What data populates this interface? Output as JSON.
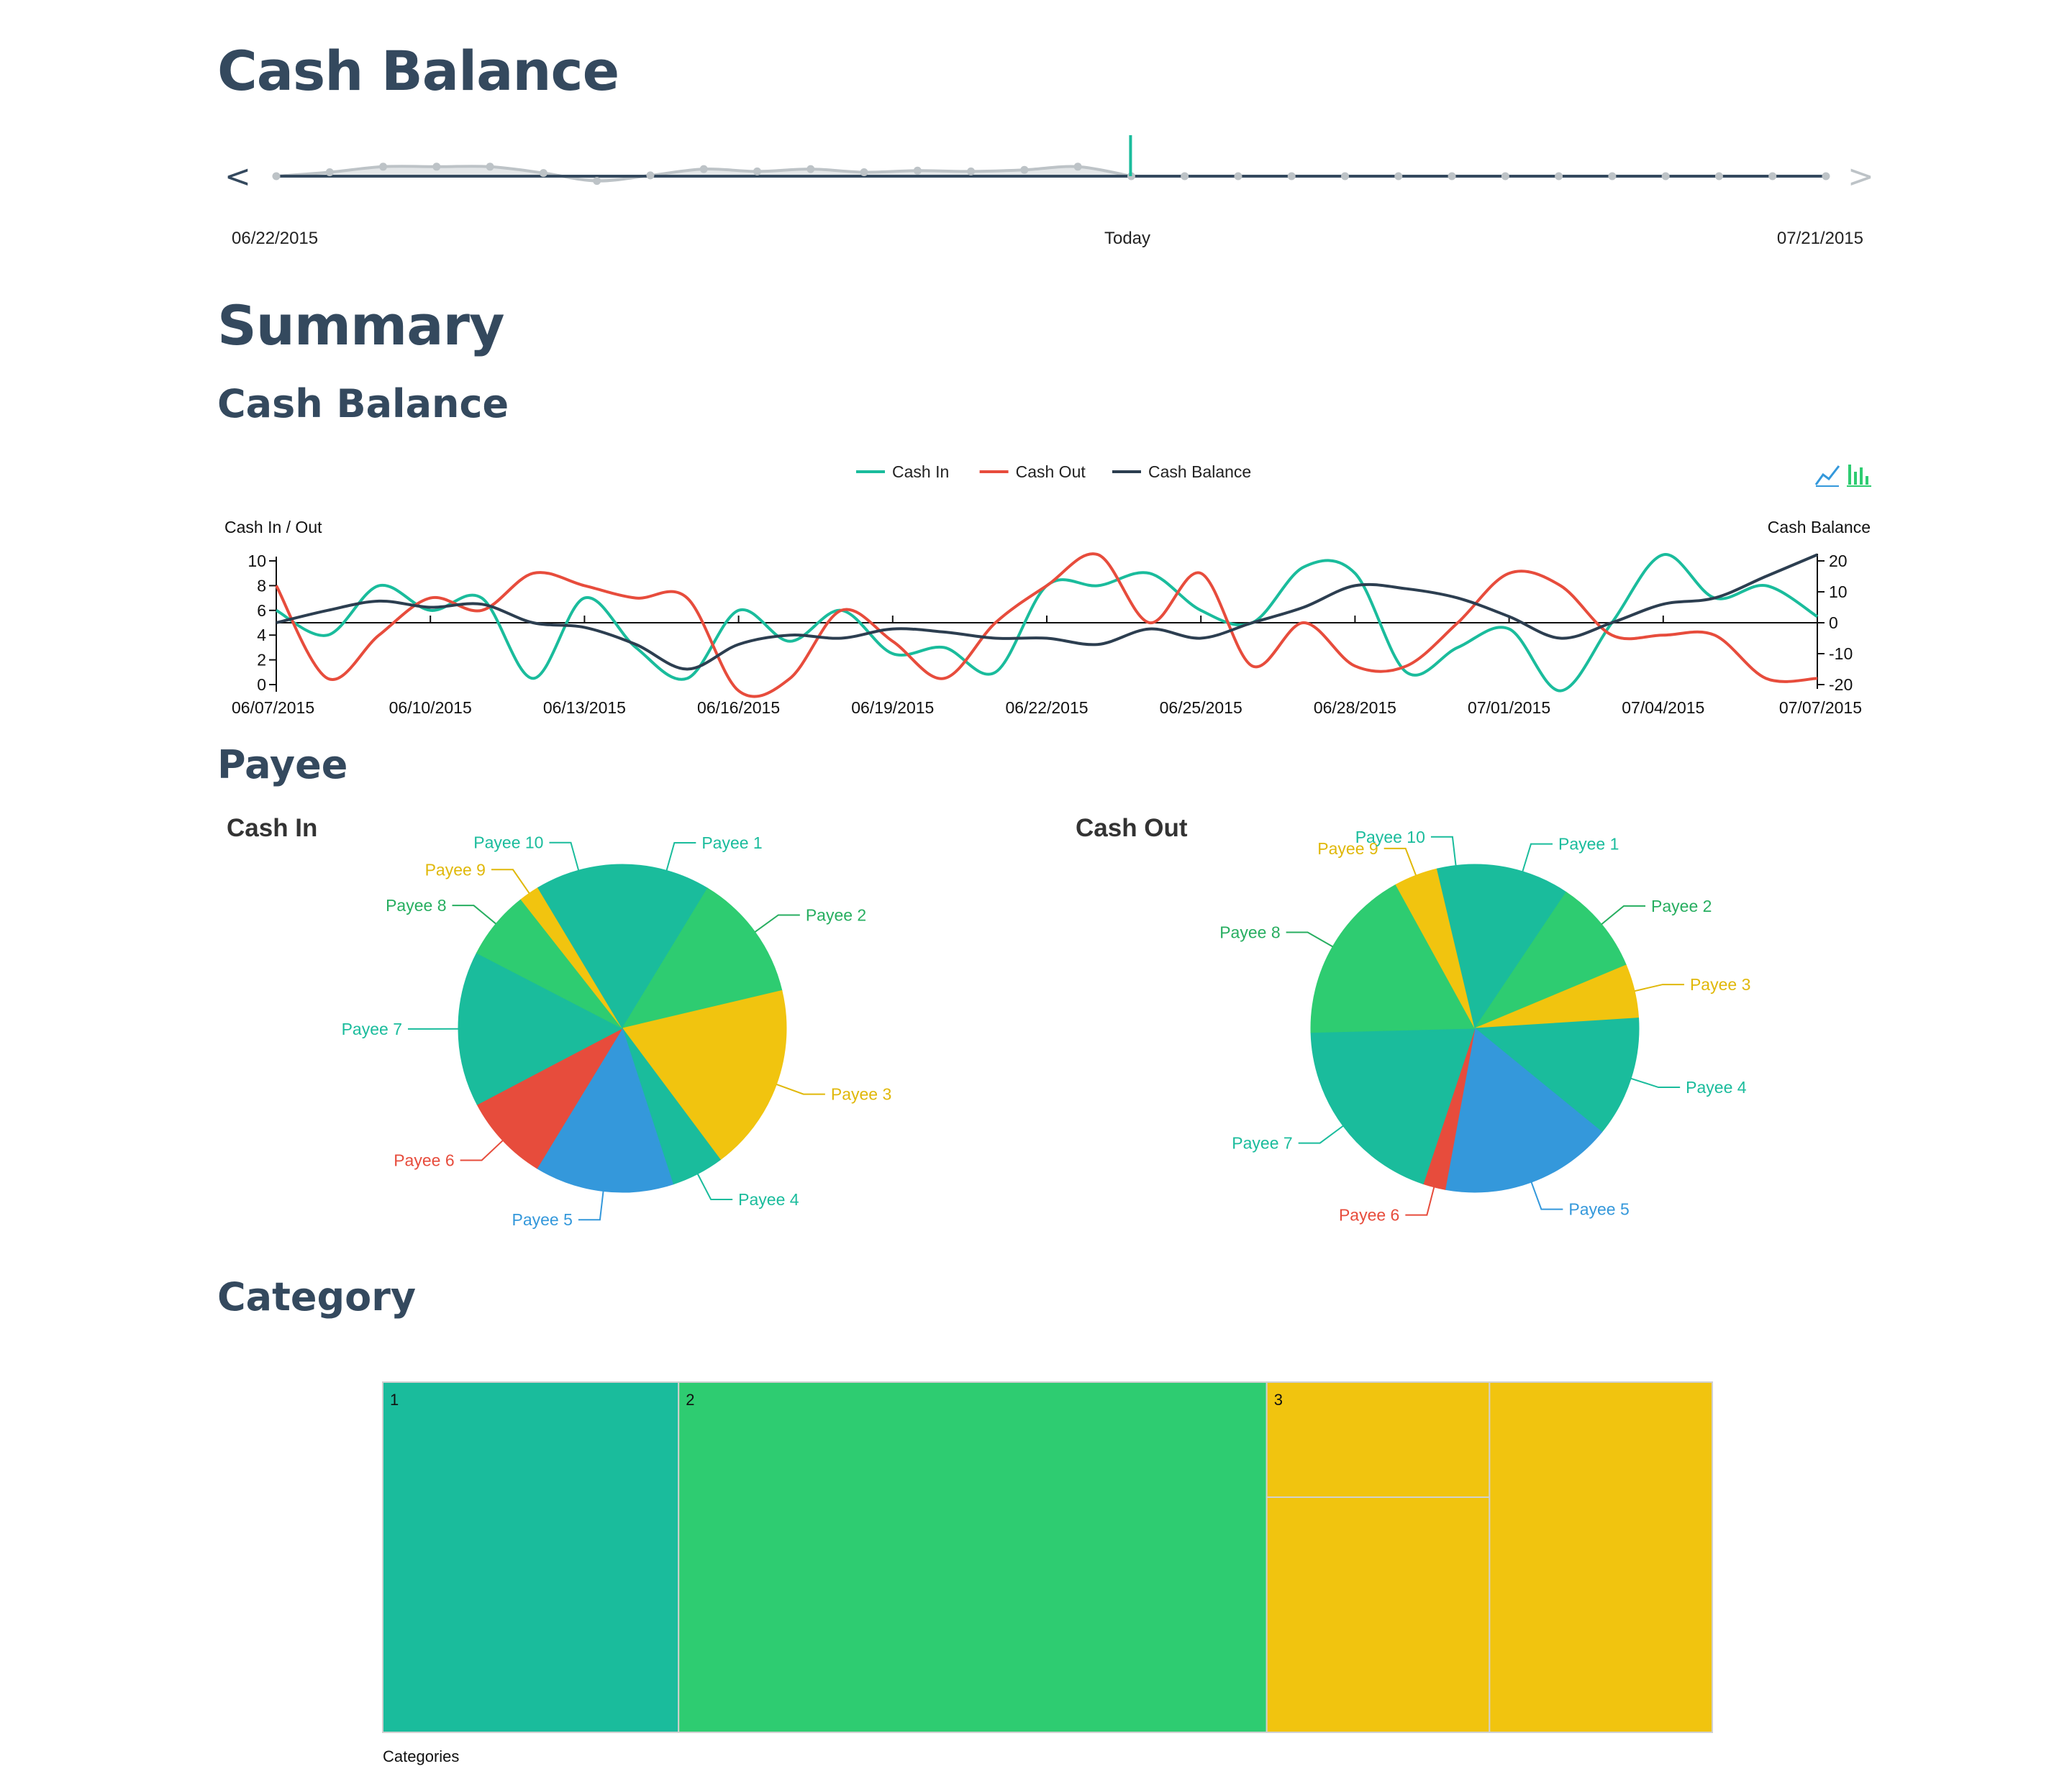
{
  "page": {
    "title": "Cash Balance",
    "summary_title": "Summary",
    "cash_balance_title": "Cash Balance",
    "payee_title": "Payee",
    "category_title": "Category"
  },
  "timeline": {
    "prev_label": "<",
    "next_label": ">",
    "start_label": "06/22/2015",
    "today_label": "Today",
    "end_label": "07/21/2015",
    "values": [
      0,
      0.5,
      1.2,
      1.2,
      1.2,
      0.4,
      -0.6,
      0.1,
      0.9,
      0.6,
      0.9,
      0.5,
      0.7,
      0.6,
      0.8,
      1.2,
      0,
      0,
      0,
      0,
      0,
      0,
      0,
      0,
      0,
      0,
      0,
      0,
      0,
      0
    ],
    "today_index": 16,
    "colors": {
      "line": "#bdc3c7",
      "fill": "#e3e6e8",
      "future": "#34495e",
      "today": "#1abc9c"
    }
  },
  "chart_data": [
    {
      "type": "line",
      "title": "",
      "legend": [
        {
          "name": "Cash In",
          "color": "#1abc9c"
        },
        {
          "name": "Cash Out",
          "color": "#e74c3c"
        },
        {
          "name": "Cash Balance",
          "color": "#2c3e50"
        }
      ],
      "legend_position": "top-center",
      "ylabel_left": "Cash In / Out",
      "ylabel_right": "Cash Balance",
      "ylim_left": [
        0,
        10
      ],
      "ylim_right": [
        -20,
        20
      ],
      "left_ticks": [
        "10",
        "8",
        "6",
        "4",
        "2",
        "0"
      ],
      "right_ticks": [
        "20",
        "10",
        "0",
        "-10",
        "-20"
      ],
      "x_tick_labels": [
        "06/07/2015",
        "06/10/2015",
        "06/13/2015",
        "06/16/2015",
        "06/19/2015",
        "06/22/2015",
        "06/25/2015",
        "06/28/2015",
        "07/01/2015",
        "07/04/2015",
        "07/07/2015"
      ],
      "x": [
        "06/07/2015",
        "06/08/2015",
        "06/09/2015",
        "06/10/2015",
        "06/11/2015",
        "06/12/2015",
        "06/13/2015",
        "06/14/2015",
        "06/15/2015",
        "06/16/2015",
        "06/17/2015",
        "06/18/2015",
        "06/19/2015",
        "06/20/2015",
        "06/21/2015",
        "06/22/2015",
        "06/23/2015",
        "06/24/2015",
        "06/25/2015",
        "06/26/2015",
        "06/27/2015",
        "06/28/2015",
        "06/29/2015",
        "06/30/2015",
        "07/01/2015",
        "07/02/2015",
        "07/03/2015",
        "07/04/2015",
        "07/05/2015",
        "07/06/2015",
        "07/07/2015"
      ],
      "series": [
        {
          "name": "Cash In",
          "axis": "left",
          "values": [
            6,
            4,
            8,
            6,
            7,
            0.5,
            7,
            3,
            0.5,
            6,
            3.5,
            6,
            2.5,
            3,
            1,
            8,
            8,
            9,
            6,
            5,
            9.5,
            9,
            1,
            3,
            4.5,
            -0.5,
            5,
            10.5,
            7,
            8,
            5.5
          ]
        },
        {
          "name": "Cash Out",
          "axis": "left",
          "values": [
            8,
            0.5,
            4,
            7,
            6,
            9,
            8,
            7,
            7,
            -0.5,
            0.5,
            6,
            3.5,
            0.5,
            5,
            8,
            10.5,
            5,
            9,
            1.5,
            5,
            1.5,
            1.5,
            5,
            9,
            8,
            4,
            4,
            4,
            0.5,
            0.5
          ]
        },
        {
          "name": "Cash Balance",
          "axis": "right",
          "values": [
            0,
            4,
            7,
            5,
            6,
            0,
            -1.5,
            -7,
            -15,
            -7,
            -4,
            -5,
            -2,
            -3,
            -5,
            -5,
            -7,
            -2,
            -5,
            0,
            5,
            12,
            11,
            8,
            2,
            -5,
            0,
            6,
            8,
            15,
            22
          ]
        }
      ]
    },
    {
      "type": "pie",
      "title": "Cash In",
      "labels": [
        "Payee 1",
        "Payee 2",
        "Payee 3",
        "Payee 4",
        "Payee 5",
        "Payee 6",
        "Payee 7",
        "Payee 8",
        "Payee 9",
        "Payee 10"
      ],
      "values": [
        8.7,
        12.6,
        18.5,
        5.2,
        13.7,
        8.6,
        15.3,
        6.8,
        2.0,
        8.6
      ],
      "colors": [
        "#1abc9c",
        "#2ecc71",
        "#f1c40f",
        "#1abc9c",
        "#3498db",
        "#e74c3c",
        "#1abc9c",
        "#2ecc71",
        "#f1c40f",
        "#1abc9c"
      ]
    },
    {
      "type": "pie",
      "title": "Cash Out",
      "labels": [
        "Payee 1",
        "Payee 2",
        "Payee 3",
        "Payee 4",
        "Payee 5",
        "Payee 6",
        "Payee 7",
        "Payee 8",
        "Payee 9",
        "Payee 10"
      ],
      "values": [
        9.4,
        9.3,
        5.3,
        11.9,
        17.0,
        2.2,
        19.5,
        17.4,
        4.3,
        3.7
      ],
      "colors": [
        "#1abc9c",
        "#2ecc71",
        "#f1c40f",
        "#1abc9c",
        "#3498db",
        "#e74c3c",
        "#1abc9c",
        "#2ecc71",
        "#f1c40f",
        "#1abc9c"
      ]
    },
    {
      "type": "treemap",
      "xlabel": "Categories",
      "cells": [
        {
          "label": "1",
          "value": 166,
          "color": "#1abc9c"
        },
        {
          "label": "2",
          "value": 330,
          "color": "#2ecc71"
        },
        {
          "label": "3",
          "value": 250,
          "color": "#f1c40f"
        }
      ]
    }
  ],
  "toolbar": {
    "line_icon_color": "#3498db",
    "bar_icon_color": "#2ecc71"
  }
}
